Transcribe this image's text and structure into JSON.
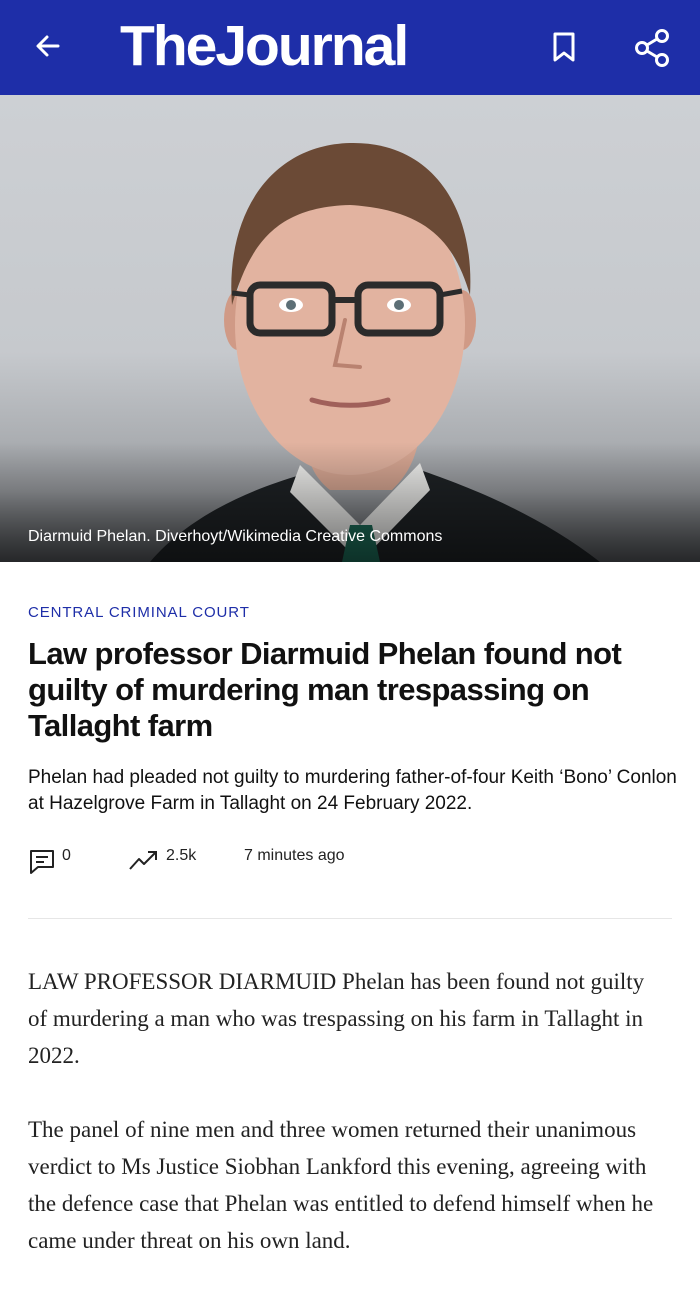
{
  "app_bar": {
    "logo": "TheJournal",
    "background": "#1e2ea8",
    "icons": [
      "back-arrow-icon",
      "bookmark-icon",
      "share-icon"
    ]
  },
  "hero": {
    "caption": "Diarmuid Phelan. Diverhoyt/Wikimedia Creative Commons"
  },
  "article": {
    "category": "CENTRAL CRIMINAL COURT",
    "headline": "Law professor Diarmuid Phelan found not guilty of murdering man trespassing on Tallaght farm",
    "standfirst": "Phelan had pleaded not guilty to murdering father-of-four Keith ‘Bono’ Conlon at Hazelgrove Farm in Tallaght on 24 February 2022.",
    "meta": {
      "comments": "0",
      "trending": "2.5k",
      "time": "7 minutes ago"
    },
    "paragraphs": [
      "LAW PROFESSOR DIARMUID Phelan has been found not guilty of murdering a man who was trespassing on his farm in Tallaght in 2022.",
      "The panel of nine men and three women returned their unanimous verdict to Ms Justice Siobhan Lankford this evening, agreeing with the defence case that Phelan was entitled to defend himself when he came under threat on his own land."
    ]
  }
}
